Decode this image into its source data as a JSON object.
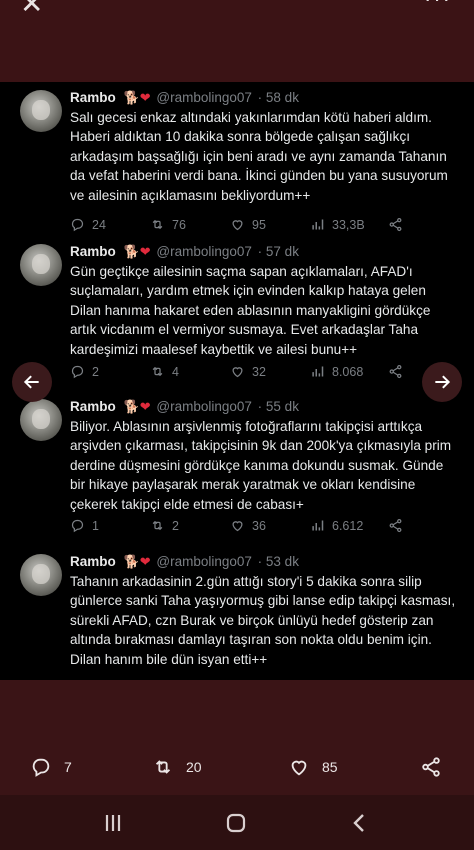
{
  "topbar": {
    "close_glyph": "✕",
    "more_glyph": "···"
  },
  "tweets": [
    {
      "name": "Rambo",
      "handle": "@rambolingo07",
      "time": "· 58 dk",
      "text": "Salı gecesi enkaz altındaki yakınlarımdan kötü haberi aldım. Haberi aldıktan 10 dakika sonra bölgede çalışan sağlıkçı arkadaşım başsağlığı için beni aradı ve aynı zamanda Tahanın da vefat haberini verdi bana. İkinci günden bu yana susuyorum ve ailesinin açıklamasını bekliyordum++",
      "replies": "24",
      "retweets": "76",
      "likes": "95",
      "views": "33,3B"
    },
    {
      "name": "Rambo",
      "handle": "@rambolingo07",
      "time": "· 57 dk",
      "text": "Gün geçtikçe ailesinin saçma sapan açıklamaları, AFAD'ı suçlamaları, yardım etmek için evinden kalkıp hataya gelen Dilan hanıma hakaret eden ablasının manyakligini gördükçe artık vicdanım el vermiyor susmaya. Evet arkadaşlar Taha kardeşimizi maalesef kaybettik ve ailesi bunu++",
      "replies": "2",
      "retweets": "4",
      "likes": "32",
      "views": "8.068"
    },
    {
      "name": "Rambo",
      "handle": "@rambolingo07",
      "time": "· 55 dk",
      "text": "Biliyor. Ablasının arşivlenmiş fotoğraflarını takipçisi arttıkça arşivden çıkarması, takipçisinin 9k dan 200k'ya çıkmasıyla prim derdine düşmesini gördükçe kanıma dokundu susmak. Günde bir hikaye paylaşarak merak yaratmak ve okları kendisine çekerek takipçi elde etmesi de cabası+",
      "replies": "1",
      "retweets": "2",
      "likes": "36",
      "views": "6.612"
    },
    {
      "name": "Rambo",
      "handle": "@rambolingo07",
      "time": "· 53 dk",
      "text": "Tahanın arkadasinin 2.gün attığı story'i 5 dakika sonra silip günlerce sanki Taha yaşıyormuş gibi lanse edip takipçi kasması, sürekli AFAD, czn Burak ve birçok ünlüyü hedef gösterip zan altında bırakması damlayı taşıran son nokta oldu benim için. Dilan hanım bile dün isyan etti++"
    }
  ],
  "bottom_actions": {
    "replies": "7",
    "retweets": "20",
    "likes": "85"
  },
  "icons": [
    "close-icon",
    "more-icon",
    "reply-icon",
    "retweet-icon",
    "like-icon",
    "views-icon",
    "share-icon",
    "arrow-left-icon",
    "arrow-right-icon",
    "recents-icon",
    "home-icon",
    "back-icon"
  ]
}
